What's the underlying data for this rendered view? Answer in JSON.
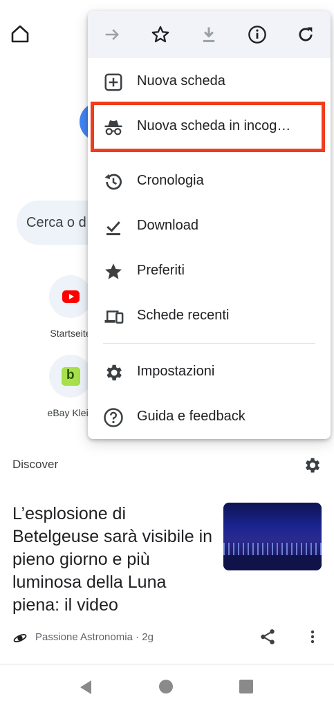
{
  "search": {
    "placeholder_visible": "Cerca o d"
  },
  "tiles": [
    {
      "label": "Startseite"
    },
    {
      "label": "eBay Klein"
    }
  ],
  "discover": {
    "label": "Discover"
  },
  "article": {
    "title": "L’esplosione di Betelgeuse sarà visibile in pieno giorno e più luminosa della Luna piena: il video",
    "source": "Passione Astronomia · 2g"
  },
  "menu": {
    "toolbar": [
      "forward-icon",
      "star-icon",
      "download-icon",
      "info-icon",
      "refresh-icon"
    ],
    "items": [
      {
        "label": "Nuova scheda",
        "icon": "new-tab-icon"
      },
      {
        "label": "Nuova scheda in incog…",
        "icon": "incognito-icon"
      },
      {
        "label": "Cronologia",
        "icon": "history-icon"
      },
      {
        "label": "Download",
        "icon": "download-done-icon"
      },
      {
        "label": "Preferiti",
        "icon": "star-filled-icon"
      },
      {
        "label": "Schede recenti",
        "icon": "devices-icon"
      },
      {
        "label": "Impostazioni",
        "icon": "settings-icon"
      },
      {
        "label": "Guida e feedback",
        "icon": "help-icon"
      }
    ]
  },
  "colors": {
    "highlight": "#f03c1f",
    "toolbar_bg": "#f1f3f8",
    "search_bg": "#eef2f9"
  }
}
